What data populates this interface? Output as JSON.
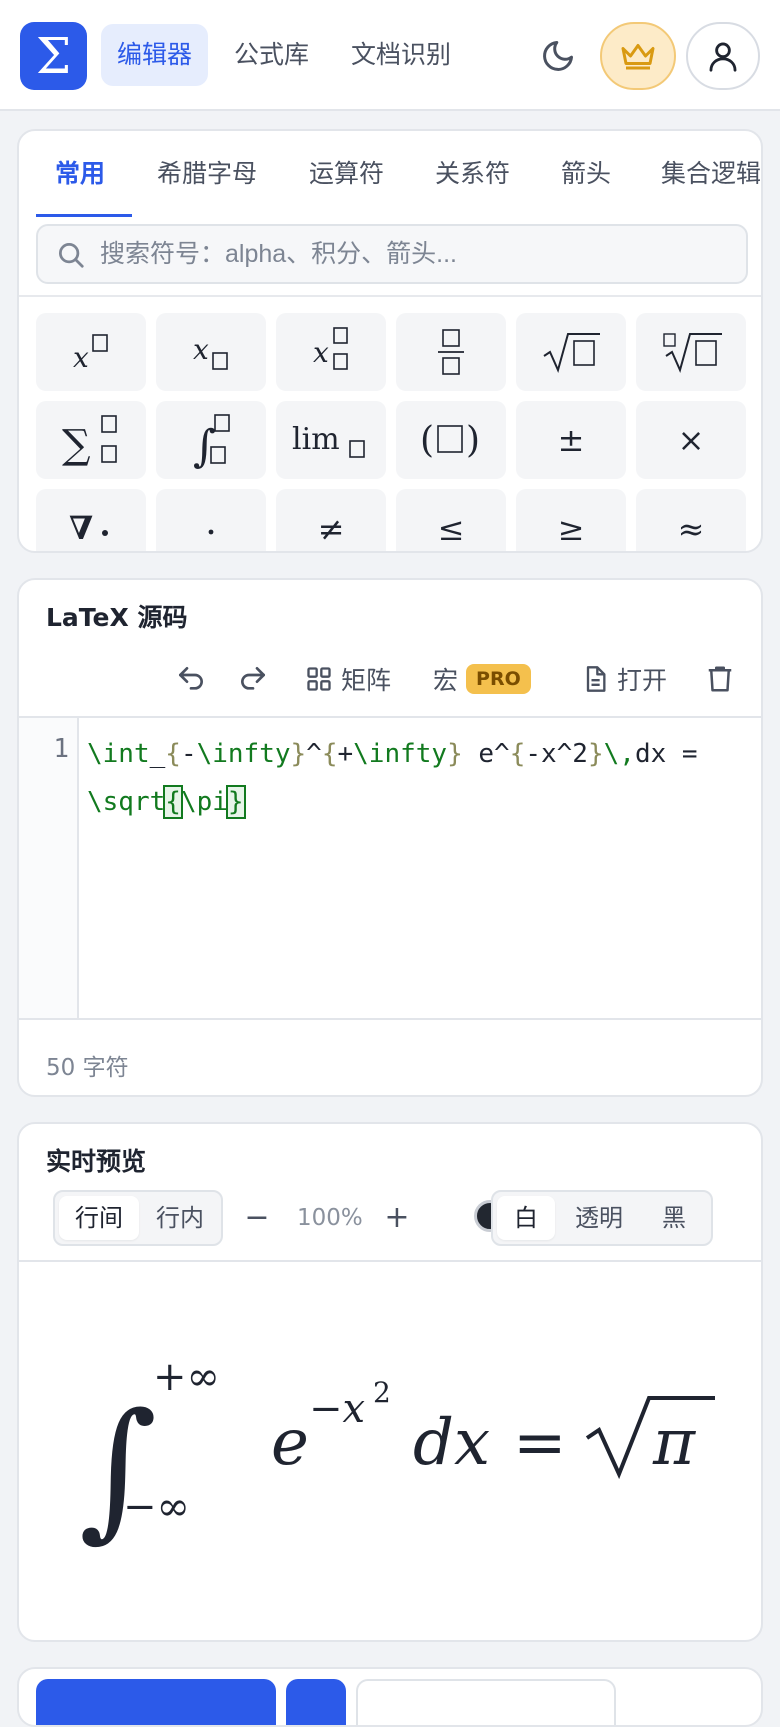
{
  "nav": {
    "logo_glyph": "Σ",
    "tabs": [
      {
        "label": "编辑器",
        "active": true
      },
      {
        "label": "公式库",
        "active": false
      },
      {
        "label": "文档识别",
        "active": false
      }
    ],
    "icons": [
      "moon-icon",
      "crown-icon",
      "user-icon"
    ]
  },
  "symbols": {
    "tabs": [
      "常用",
      "希腊字母",
      "运算符",
      "关系符",
      "箭头",
      "集合逻辑"
    ],
    "active_tab": "常用",
    "search_placeholder": "搜索符号：alpha、积分、箭头..."
  },
  "latex": {
    "title": "LaTeX 源码",
    "toolbar": {
      "matrix_label": "矩阵",
      "macro_label": "宏",
      "pro_badge": "PRO",
      "open_label": "打开"
    },
    "line_number": "1",
    "source": "\\int_{-\\infty}^{+\\infty} e^{-x^2}\\,dx = \\sqrt{\\pi}",
    "char_count": "50 字符"
  },
  "preview": {
    "title": "实时预览",
    "mode": {
      "block": "行间",
      "inline": "行内",
      "active": "行间"
    },
    "zoom_minus": "−",
    "zoom_value": "100%",
    "zoom_plus": "+",
    "background": {
      "white": "白",
      "transparent": "透明",
      "black": "黑",
      "active": "白"
    },
    "formula": {
      "lower": "−∞",
      "upper": "+∞",
      "base": "e",
      "exp": "−x",
      "exp2": "2",
      "dx": "dx",
      "eq": "=",
      "pi": "π"
    }
  },
  "colors": {
    "accent": "#2c5ae9",
    "code_command": "#127a1f",
    "pro_badge": "#f4c04d",
    "crown": "#d99a12"
  }
}
